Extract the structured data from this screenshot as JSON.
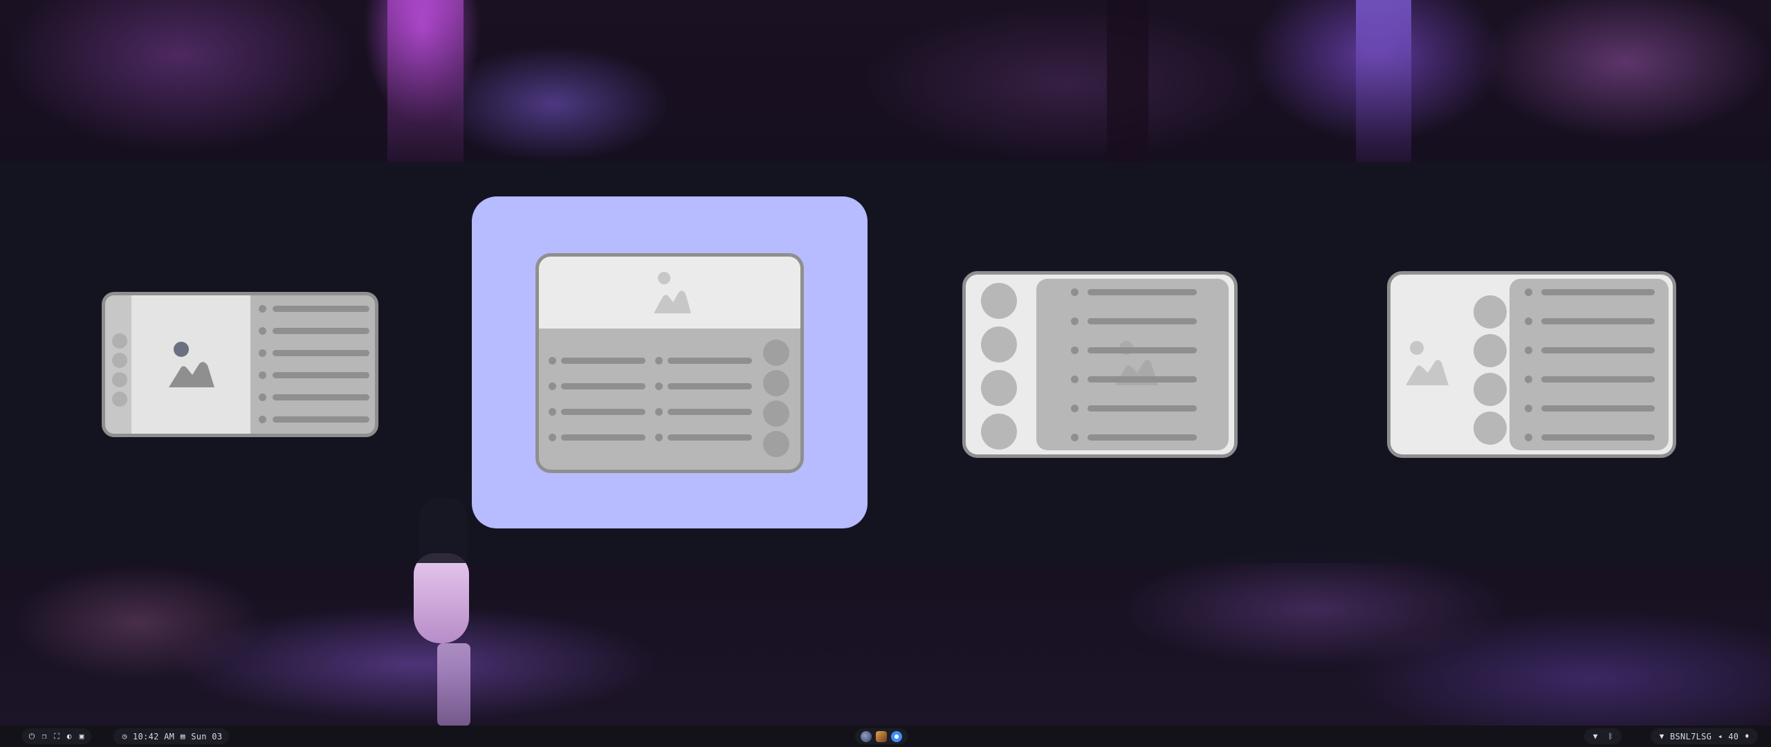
{
  "layout_switcher": {
    "options": [
      {
        "name": "layout-sidebar-left",
        "selected": false
      },
      {
        "name": "layout-header-grid",
        "selected": true
      },
      {
        "name": "layout-sidebar-circles",
        "selected": false
      },
      {
        "name": "layout-split-circles",
        "selected": false
      }
    ],
    "colors": {
      "selected": "#b6bcff",
      "overlay": "#141421",
      "card": "#ebebeb",
      "panel": "#b7b7b7",
      "accent": "#8f8f8f"
    }
  },
  "taskbar": {
    "left_icons": [
      "power-icon",
      "copy-icon",
      "screenshot-icon",
      "palette-icon",
      "lock-icon"
    ],
    "clock": {
      "time": "10:42 AM",
      "date": "Sun 03",
      "clock_icon": "clock-icon",
      "calendar_icon": "calendar-icon"
    },
    "workspace_apps": [
      "firefox-icon",
      "app-orange-icon",
      "browser-blue-icon"
    ],
    "tray": {
      "wifi_icon": "wifi-icon",
      "bluetooth_icon": "bluetooth-icon"
    },
    "status": {
      "network_name": "BSNL7LSG",
      "volume": "40",
      "volume_icon": "volume-icon",
      "wifi_icon": "wifi-icon",
      "mic_icon": "mic-icon"
    }
  }
}
